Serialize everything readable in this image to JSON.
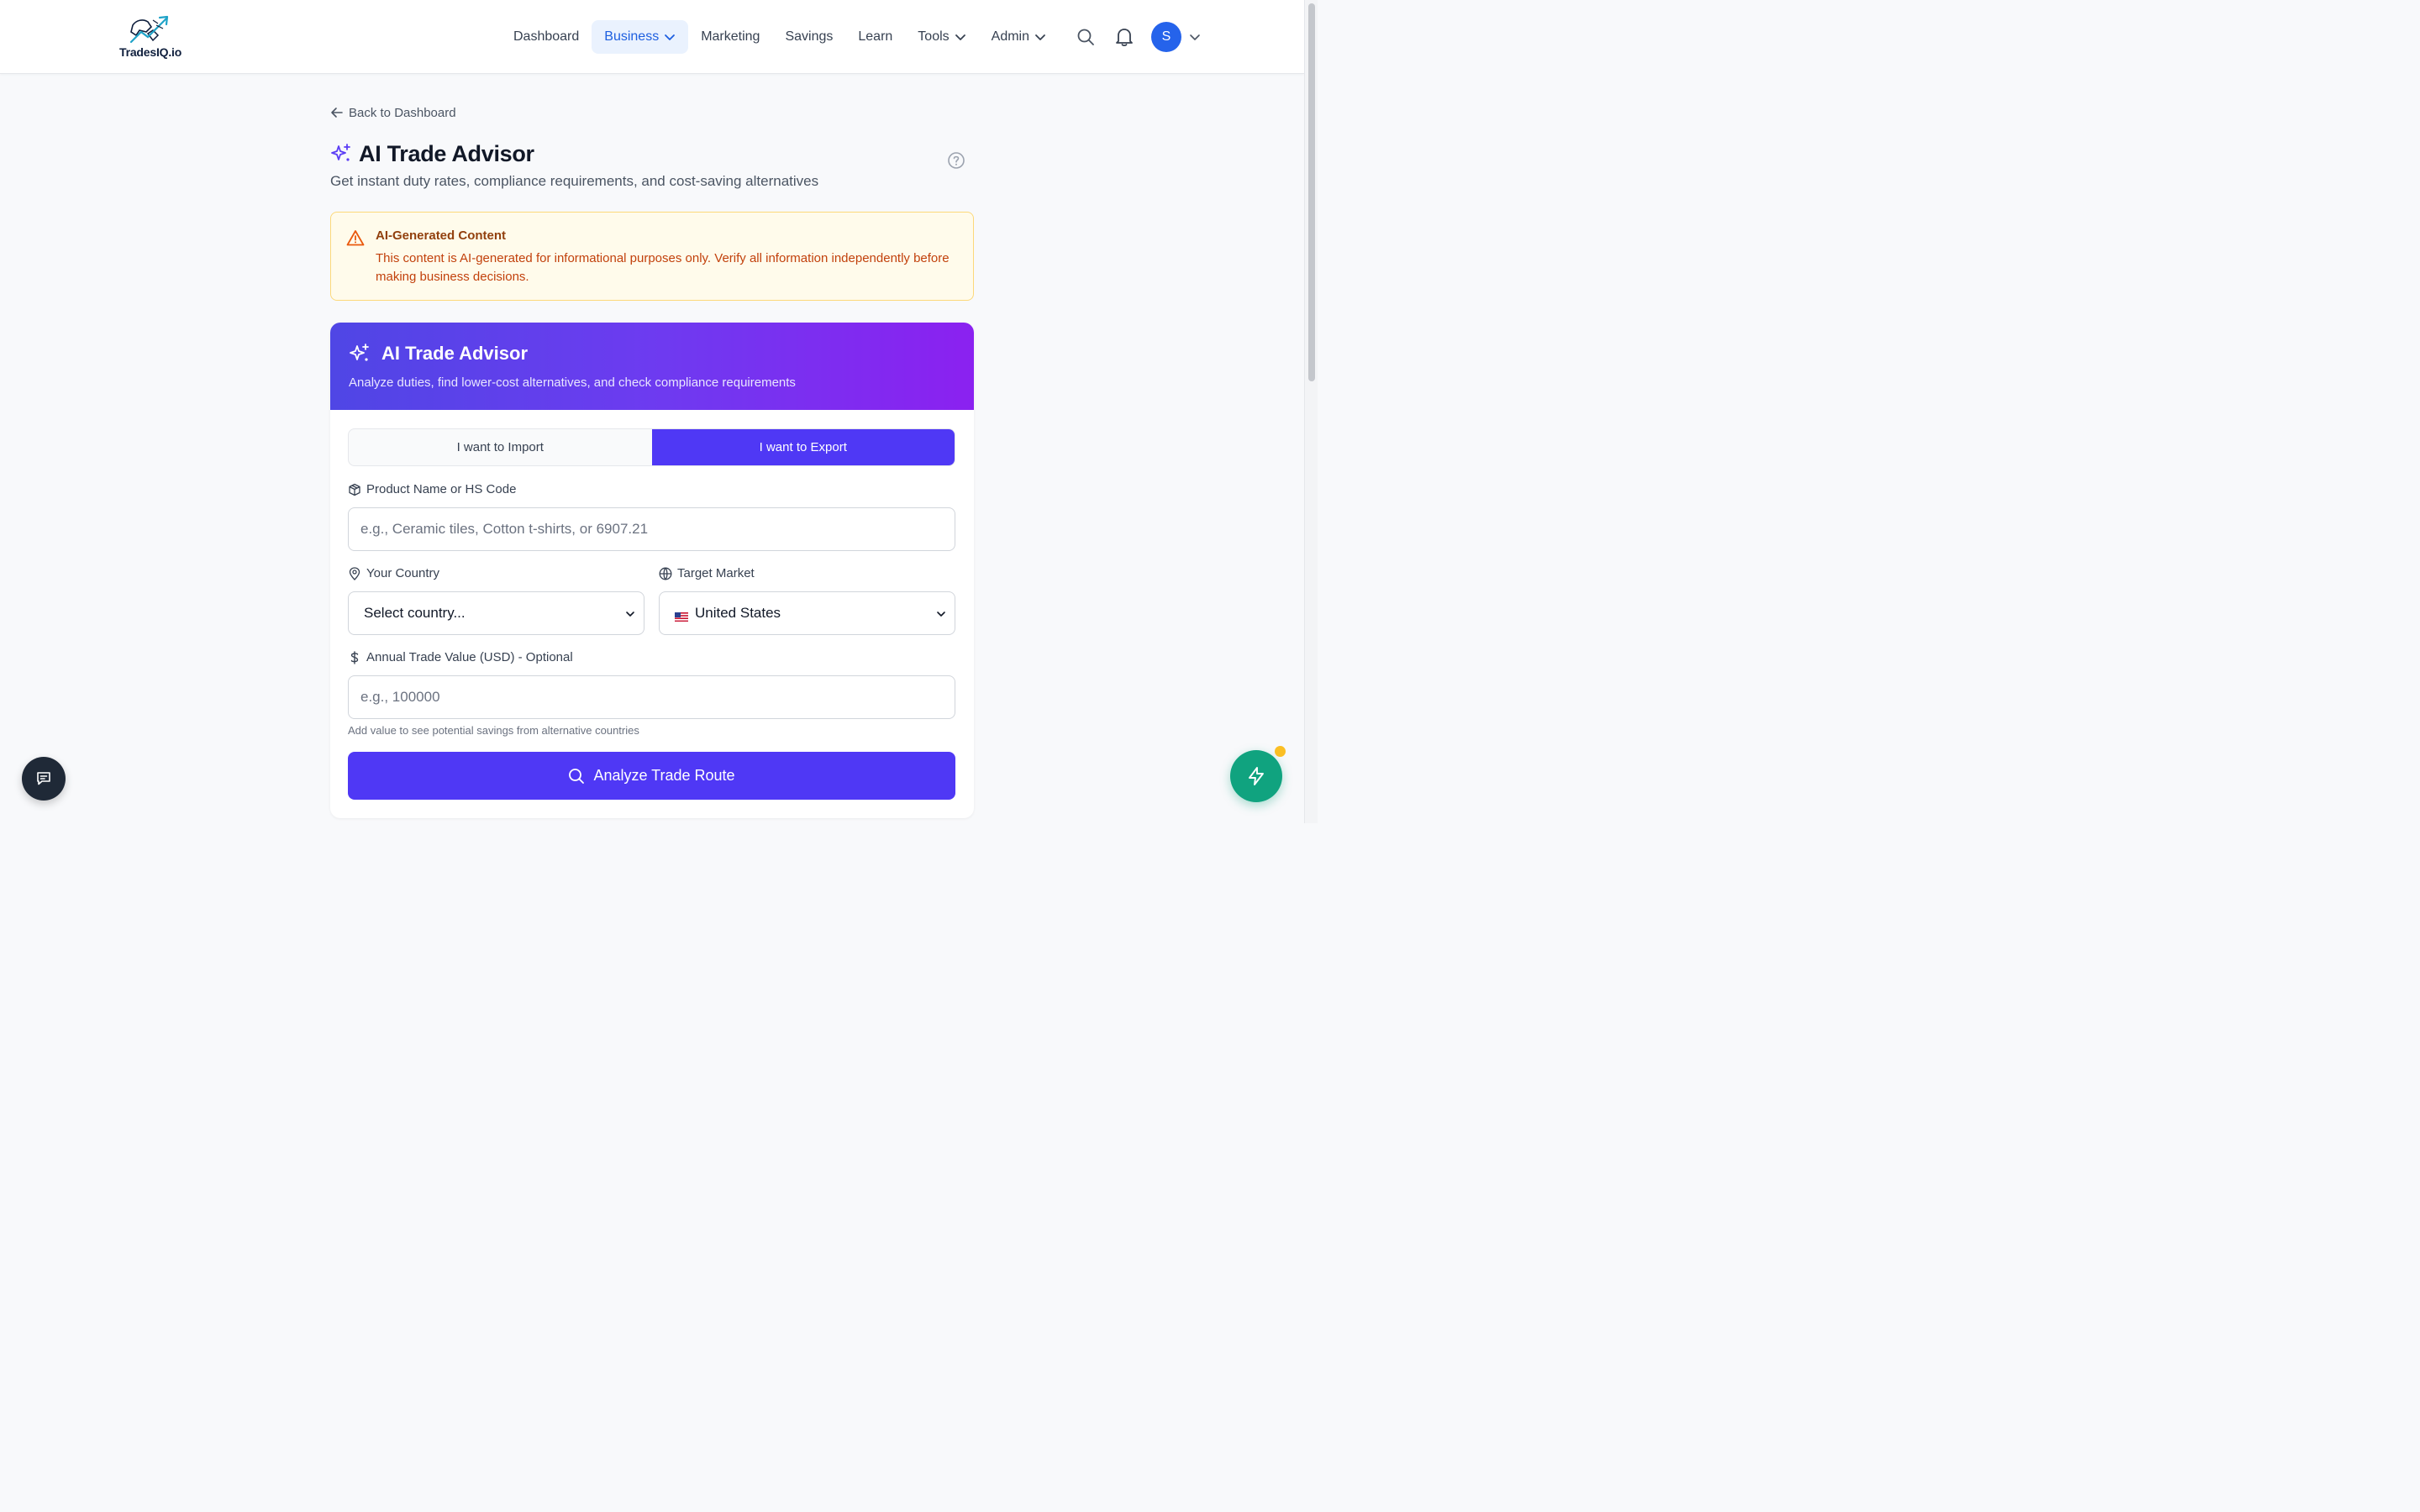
{
  "brand": {
    "name": "TradesIQ.io"
  },
  "nav": {
    "items": [
      {
        "label": "Dashboard",
        "dropdown": false,
        "active": false
      },
      {
        "label": "Business",
        "dropdown": true,
        "active": true
      },
      {
        "label": "Marketing",
        "dropdown": false,
        "active": false
      },
      {
        "label": "Savings",
        "dropdown": false,
        "active": false
      },
      {
        "label": "Learn",
        "dropdown": false,
        "active": false
      },
      {
        "label": "Tools",
        "dropdown": true,
        "active": false
      },
      {
        "label": "Admin",
        "dropdown": true,
        "active": false
      }
    ],
    "user_initial": "S"
  },
  "page": {
    "back_label": "Back to Dashboard",
    "title": "AI Trade Advisor",
    "subtitle": "Get instant duty rates, compliance requirements, and cost-saving alternatives"
  },
  "warning": {
    "title": "AI-Generated Content",
    "body": "This content is AI-generated for informational purposes only. Verify all information independently before making business decisions."
  },
  "advisor": {
    "title": "AI Trade Advisor",
    "subtitle": "Analyze duties, find lower-cost alternatives, and check compliance requirements",
    "toggle": {
      "import_label": "I want to Import",
      "export_label": "I want to Export",
      "selected": "export"
    },
    "product": {
      "label": "Product Name or HS Code",
      "placeholder": "e.g., Ceramic tiles, Cotton t-shirts, or 6907.21",
      "value": ""
    },
    "country": {
      "label": "Your Country",
      "value": "Select country..."
    },
    "market": {
      "label": "Target Market",
      "value": "United States"
    },
    "trade_value": {
      "label": "Annual Trade Value (USD) - Optional",
      "placeholder": "e.g., 100000",
      "value": "",
      "hint": "Add value to see potential savings from alternative countries"
    },
    "analyze_label": "Analyze Trade Route"
  },
  "colors": {
    "primary": "#4f38f5",
    "nav_active_bg": "#eaf2fe",
    "nav_active_text": "#1d5fe0",
    "warning_bg": "#fffbeb",
    "warning_title": "#92400e",
    "warning_text": "#c2410c",
    "fab_green": "#10a37f"
  }
}
